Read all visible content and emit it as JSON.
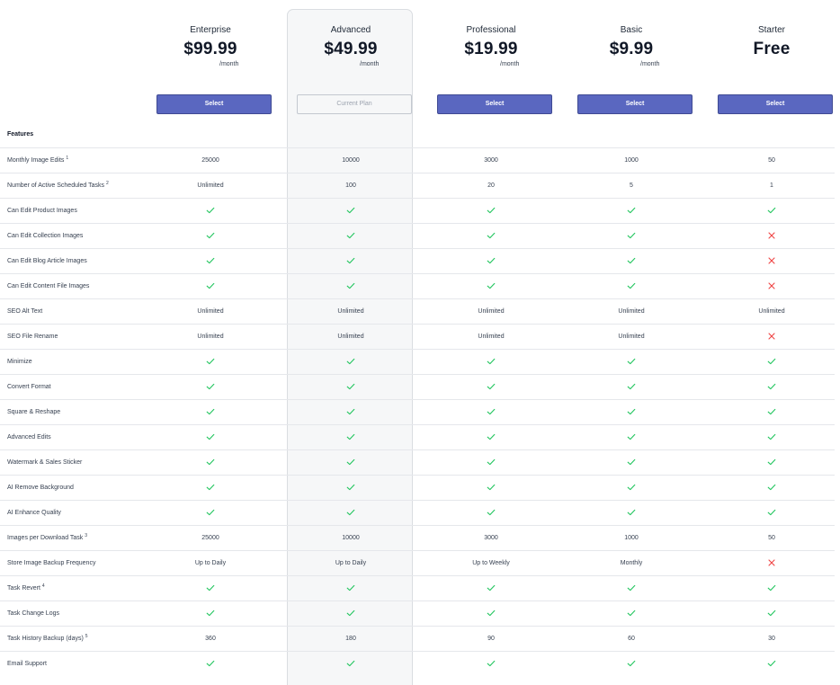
{
  "plans": [
    {
      "name": "Enterprise",
      "price": "$99.99",
      "period": "/month",
      "button": "Select",
      "current": false
    },
    {
      "name": "Advanced",
      "price": "$49.99",
      "period": "/month",
      "button": "Current Plan",
      "current": true
    },
    {
      "name": "Professional",
      "price": "$19.99",
      "period": "/month",
      "button": "Select",
      "current": false
    },
    {
      "name": "Basic",
      "price": "$9.99",
      "period": "/month",
      "button": "Select",
      "current": false
    },
    {
      "name": "Starter",
      "price": "Free",
      "period": "",
      "button": "Select",
      "current": false
    }
  ],
  "features_heading": "Features",
  "colors": {
    "accent": "#5a67c0",
    "check": "#22c55e",
    "cross": "#ef4444"
  },
  "rows": [
    {
      "label": "Monthly Image Edits",
      "note": "1",
      "values": [
        "25000",
        "10000",
        "3000",
        "1000",
        "50"
      ]
    },
    {
      "label": "Number of Active Scheduled Tasks",
      "note": "2",
      "values": [
        "Unlimited",
        "100",
        "20",
        "5",
        "1"
      ]
    },
    {
      "label": "Can Edit Product Images",
      "note": "",
      "values": [
        true,
        true,
        true,
        true,
        true
      ]
    },
    {
      "label": "Can Edit Collection Images",
      "note": "",
      "values": [
        true,
        true,
        true,
        true,
        false
      ]
    },
    {
      "label": "Can Edit Blog Article Images",
      "note": "",
      "values": [
        true,
        true,
        true,
        true,
        false
      ]
    },
    {
      "label": "Can Edit Content File Images",
      "note": "",
      "values": [
        true,
        true,
        true,
        true,
        false
      ]
    },
    {
      "label": "SEO Alt Text",
      "note": "",
      "values": [
        "Unlimited",
        "Unlimited",
        "Unlimited",
        "Unlimited",
        "Unlimited"
      ]
    },
    {
      "label": "SEO File Rename",
      "note": "",
      "values": [
        "Unlimited",
        "Unlimited",
        "Unlimited",
        "Unlimited",
        false
      ]
    },
    {
      "label": "Minimize",
      "note": "",
      "values": [
        true,
        true,
        true,
        true,
        true
      ]
    },
    {
      "label": "Convert Format",
      "note": "",
      "values": [
        true,
        true,
        true,
        true,
        true
      ]
    },
    {
      "label": "Square & Reshape",
      "note": "",
      "values": [
        true,
        true,
        true,
        true,
        true
      ]
    },
    {
      "label": "Advanced Edits",
      "note": "",
      "values": [
        true,
        true,
        true,
        true,
        true
      ]
    },
    {
      "label": "Watermark & Sales Sticker",
      "note": "",
      "values": [
        true,
        true,
        true,
        true,
        true
      ]
    },
    {
      "label": "AI Remove Background",
      "note": "",
      "values": [
        true,
        true,
        true,
        true,
        true
      ]
    },
    {
      "label": "AI Enhance Quality",
      "note": "",
      "values": [
        true,
        true,
        true,
        true,
        true
      ]
    },
    {
      "label": "Images per Download Task",
      "note": "3",
      "values": [
        "25000",
        "10000",
        "3000",
        "1000",
        "50"
      ]
    },
    {
      "label": "Store Image Backup Frequency",
      "note": "",
      "values": [
        "Up to Daily",
        "Up to Daily",
        "Up to Weekly",
        "Monthly",
        false
      ]
    },
    {
      "label": "Task Revert",
      "note": "4",
      "values": [
        true,
        true,
        true,
        true,
        true
      ]
    },
    {
      "label": "Task Change Logs",
      "note": "",
      "values": [
        true,
        true,
        true,
        true,
        true
      ]
    },
    {
      "label": "Task History Backup (days)",
      "note": "5",
      "values": [
        "360",
        "180",
        "90",
        "60",
        "30"
      ]
    },
    {
      "label": "Email Support",
      "note": "",
      "values": [
        true,
        true,
        true,
        true,
        true
      ]
    }
  ]
}
